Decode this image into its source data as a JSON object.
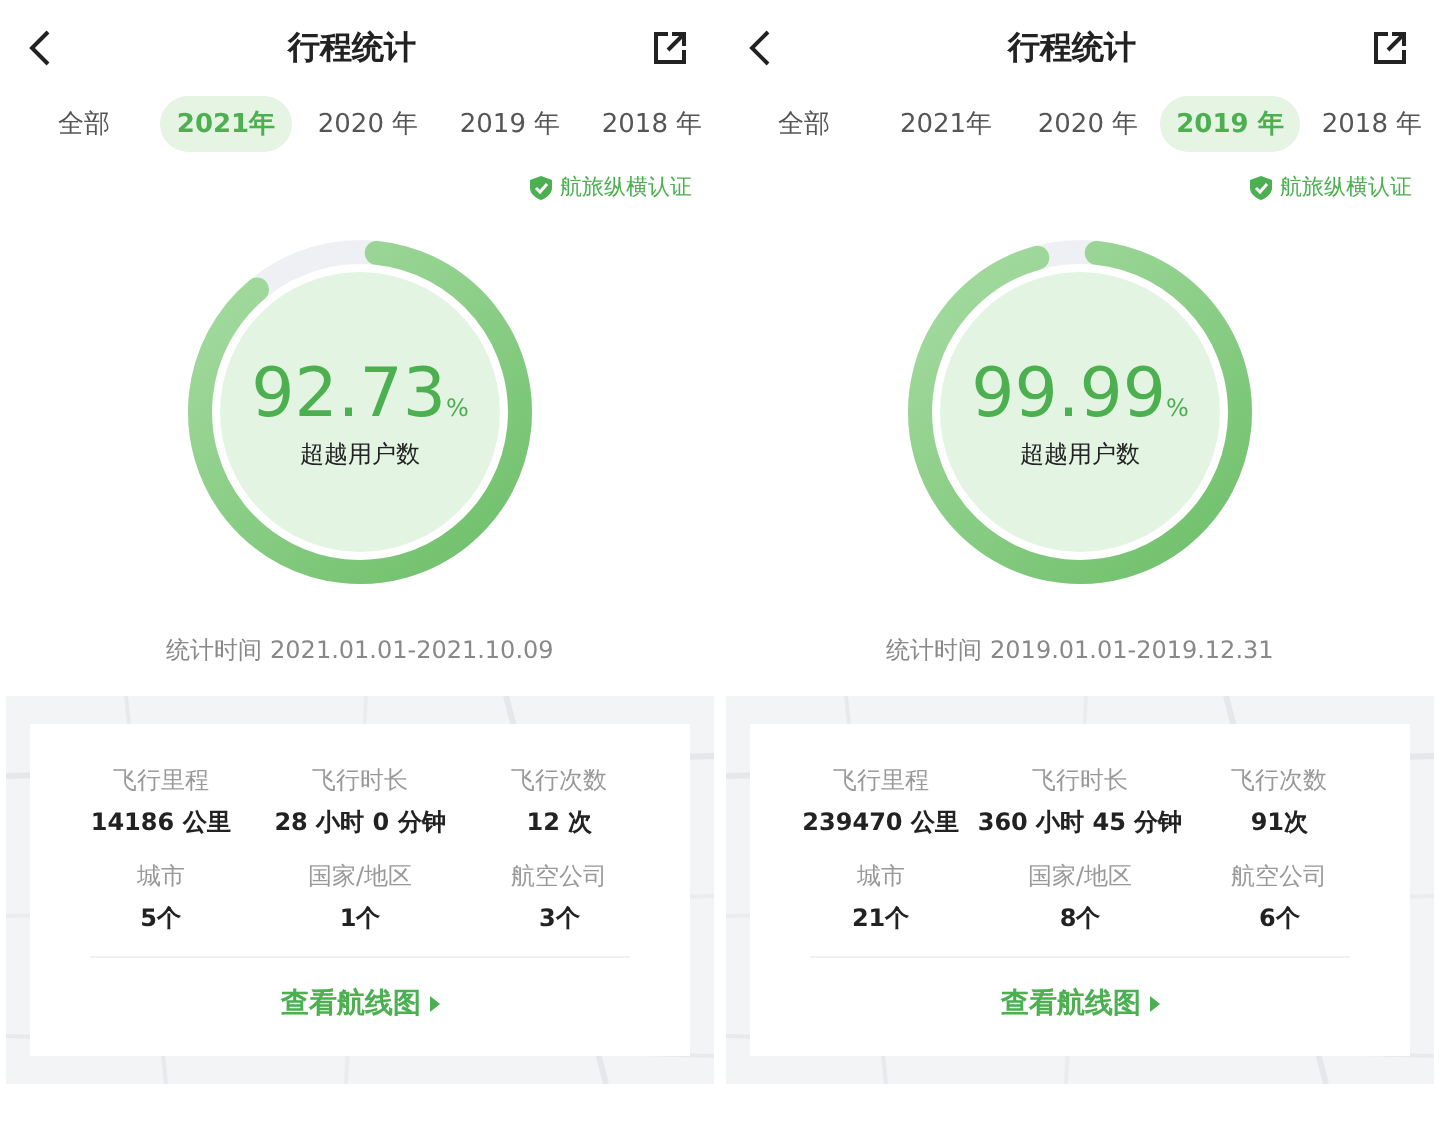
{
  "panels": [
    {
      "title": "行程统计",
      "tabs": [
        {
          "label": "全部",
          "selected": false
        },
        {
          "label": "2021年",
          "selected": true
        },
        {
          "label": "2020 年",
          "selected": false
        },
        {
          "label": "2019 年",
          "selected": false
        },
        {
          "label": "2018 年",
          "selected": false
        }
      ],
      "badge": "航旅纵横认证",
      "ring": {
        "level": 0.9273,
        "value": "92.73",
        "unit": "%",
        "caption": "超越用户数"
      },
      "period": "统计时间 2021.01.01-2021.10.09",
      "stats": [
        {
          "label": "飞行里程",
          "value": "14186 公里"
        },
        {
          "label": "飞行时长",
          "value": "28 小时 0 分钟"
        },
        {
          "label": "飞行次数",
          "value": "12 次"
        },
        {
          "label": "城市",
          "value": "5个"
        },
        {
          "label": "国家/地区",
          "value": "1个"
        },
        {
          "label": "航空公司",
          "value": "3个"
        }
      ],
      "route_link": "查看航线图"
    },
    {
      "title": "行程统计",
      "tabs": [
        {
          "label": "全部",
          "selected": false
        },
        {
          "label": "2021年",
          "selected": false
        },
        {
          "label": "2020 年",
          "selected": false
        },
        {
          "label": "2019 年",
          "selected": true
        },
        {
          "label": "2018 年",
          "selected": false
        }
      ],
      "badge": "航旅纵横认证",
      "ring": {
        "level": 0.9999,
        "value": "99.99",
        "unit": "%",
        "caption": "超越用户数"
      },
      "period": "统计时间 2019.01.01-2019.12.31",
      "stats": [
        {
          "label": "飞行里程",
          "value": "239470 公里"
        },
        {
          "label": "飞行时长",
          "value": "360 小时 45 分钟"
        },
        {
          "label": "飞行次数",
          "value": "91次"
        },
        {
          "label": "城市",
          "value": "21个"
        },
        {
          "label": "国家/地区",
          "value": "8个"
        },
        {
          "label": "航空公司",
          "value": "6个"
        }
      ],
      "route_link": "查看航线图"
    }
  ]
}
